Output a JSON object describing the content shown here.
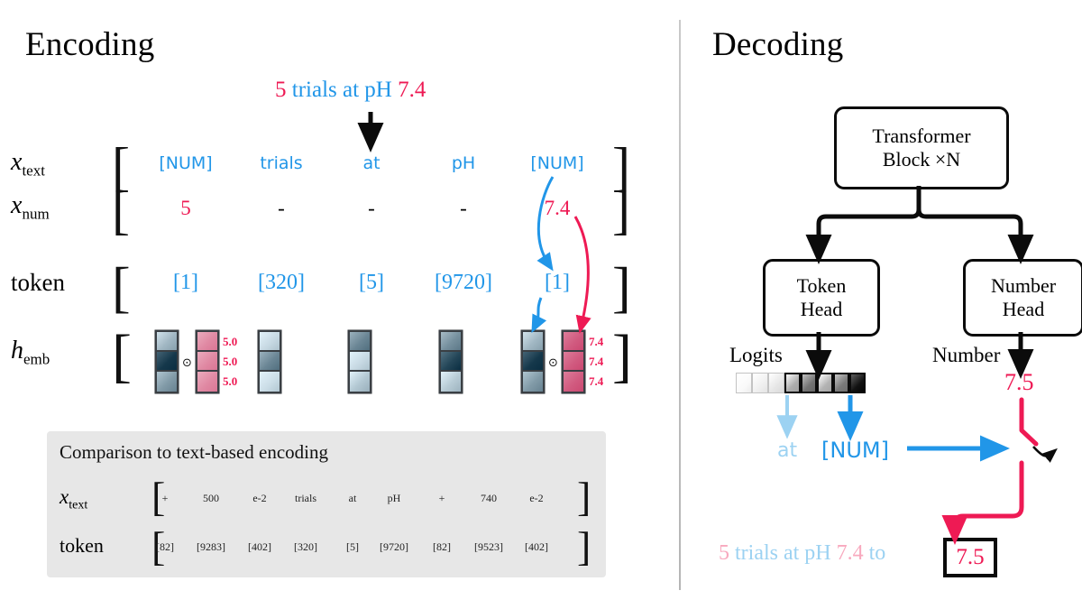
{
  "sections": {
    "encoding_title": "Encoding",
    "decoding_title": "Decoding"
  },
  "colors": {
    "pink": "#EE1A54",
    "blue": "#2196E8",
    "pink_light": "#F8A9BE",
    "blue_light": "#9CD2F2",
    "panel_bg": "#e7e7e7",
    "outline": "#0b0b0b"
  },
  "encoding": {
    "input_sentence": {
      "parts": [
        {
          "text": "5",
          "color": "pink"
        },
        {
          "text": "trials at pH",
          "color": "blue"
        },
        {
          "text": "7.4",
          "color": "pink"
        }
      ]
    },
    "rows": [
      {
        "name": "x_text",
        "label_base": "x",
        "label_sub": "text",
        "cells": [
          "[NUM]",
          "trials",
          "at",
          "pH",
          "[NUM]"
        ],
        "color": "blue"
      },
      {
        "name": "x_num",
        "label_base": "x",
        "label_sub": "num",
        "cells": [
          "5",
          "-",
          "-",
          "-",
          "7.4"
        ],
        "cell_colors": [
          "pink",
          "black",
          "black",
          "black",
          "pink"
        ]
      },
      {
        "name": "token",
        "label_base": "token",
        "label_sub": "",
        "cells": [
          "[1]",
          "[320]",
          "[5]",
          "[9720]",
          "[1]"
        ],
        "color": "blue"
      },
      {
        "name": "h_emb",
        "label_base": "h",
        "label_sub": "emb",
        "cells": [
          "",
          "",
          "",
          "",
          ""
        ]
      }
    ],
    "embeddings": [
      {
        "token_shades": [
          0.3,
          0.95,
          0.45
        ],
        "has_number": true,
        "number_shades": [
          0.45,
          0.45,
          0.45
        ],
        "number_labels": [
          "5.0",
          "5.0",
          "5.0"
        ],
        "operator": "⊙"
      },
      {
        "token_shades": [
          0.12,
          0.55,
          0.1
        ],
        "has_number": false
      },
      {
        "token_shades": [
          0.55,
          0.12,
          0.22
        ],
        "has_number": false
      },
      {
        "token_shades": [
          0.5,
          0.88,
          0.2
        ],
        "has_number": false
      },
      {
        "token_shades": [
          0.3,
          0.95,
          0.45
        ],
        "has_number": true,
        "number_shades": [
          0.75,
          0.75,
          0.75
        ],
        "number_labels": [
          "7.4",
          "7.4",
          "7.4"
        ],
        "operator": "⊙"
      }
    ],
    "comparison": {
      "title": "Comparison to text-based encoding",
      "rows": [
        {
          "label_base": "x",
          "label_sub": "text",
          "cells": [
            "+",
            "500",
            "e-2",
            "trials",
            "at",
            "pH",
            "+",
            "740",
            "e-2"
          ]
        },
        {
          "label_base": "token",
          "label_sub": "",
          "cells": [
            "[82]",
            "[9283]",
            "[402]",
            "[320]",
            "[5]",
            "[9720]",
            "[82]",
            "[9523]",
            "[402]"
          ]
        }
      ]
    }
  },
  "decoding": {
    "transformer_block": {
      "line1": "Transformer",
      "line2": "Block ×N"
    },
    "token_head": {
      "line1": "Token",
      "line2": "Head"
    },
    "number_head": {
      "line1": "Number",
      "line2": "Head"
    },
    "logits_label": "Logits",
    "number_label": "Number",
    "logits_values": [
      0.02,
      0.06,
      0.1,
      0.32,
      0.55,
      0.3,
      0.52,
      0.93
    ],
    "logits_bold_from": 3,
    "predicted_token_faded": "at",
    "predicted_token": "[NUM]",
    "predicted_number": "7.5",
    "output": {
      "parts": [
        {
          "text": "5",
          "color": "pink_light"
        },
        {
          "text": "trials at pH",
          "color": "blue_light"
        },
        {
          "text": "7.4",
          "color": "pink_light"
        },
        {
          "text": "to",
          "color": "blue_light"
        }
      ],
      "boxed_value": "7.5"
    }
  }
}
